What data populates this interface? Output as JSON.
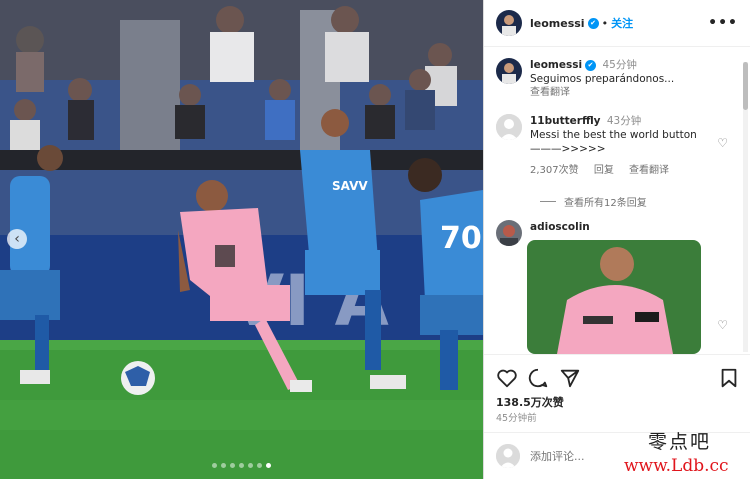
{
  "post": {
    "username": "leomessi",
    "follow_label": "关注",
    "more_label": "•••",
    "caption_time": "45分钟",
    "caption_text": "Seguimos preparándonos...",
    "caption_translate": "查看翻译"
  },
  "comments": [
    {
      "username": "11butterffly",
      "time": "43分钟",
      "text_line1": "Messi the best the world button",
      "text_line2": "———>>>>>",
      "likes": "2,307次赞",
      "reply_label": "回复",
      "translate_label": "查看翻译",
      "view_replies": "查看所有12条回复"
    },
    {
      "username": "adioscolin"
    }
  ],
  "actions": {
    "likes": "138.5万次赞",
    "time_ago": "45分钟前"
  },
  "add_comment": {
    "placeholder": "添加评论..."
  },
  "carousel": {
    "total_slides": 7,
    "active_slide": 7,
    "prev_label": "‹"
  },
  "watermark": {
    "line1": "零点吧",
    "line2": "www.Ldb.cc"
  },
  "colors": {
    "accent": "#0095f6",
    "pink_kit": "#f4a7c0",
    "blue_kit": "#3a8bd6",
    "pitch": "#3f9a3c"
  }
}
